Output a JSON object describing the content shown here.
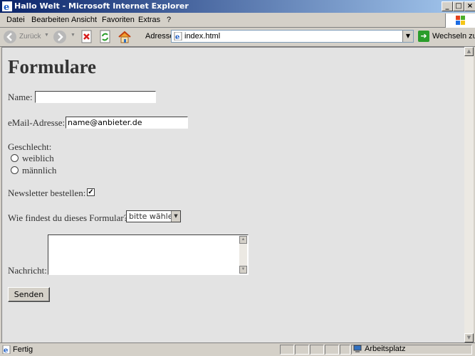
{
  "window": {
    "title": "Hallo Welt - Microsoft Internet Explorer",
    "min_glyph": "_",
    "max_glyph": "□",
    "close_glyph": "×"
  },
  "menu": {
    "items": [
      "Datei",
      "Bearbeiten",
      "Ansicht",
      "Favoriten",
      "Extras",
      "?"
    ]
  },
  "toolbar": {
    "back_label": "Zurück",
    "address_label": "Adresse",
    "address_value": "index.html",
    "go_label": "Wechseln zu"
  },
  "page": {
    "title": "Formulare",
    "name_label": "Name:",
    "name_value": "",
    "email_label": "eMail-Adresse:",
    "email_value": "name@anbieter.de",
    "gender_label": "Geschlecht:",
    "gender_options": [
      "weiblich",
      "männlich"
    ],
    "newsletter_label": "Newsletter bestellen:",
    "newsletter_checked_glyph": "✓",
    "rating_label": "Wie findest du dieses Formular?",
    "rating_selected": "bitte wählen",
    "message_label": "Nachricht:",
    "submit_label": "Senden"
  },
  "status": {
    "text": "Fertig",
    "zone": "Arbeitsplatz"
  }
}
